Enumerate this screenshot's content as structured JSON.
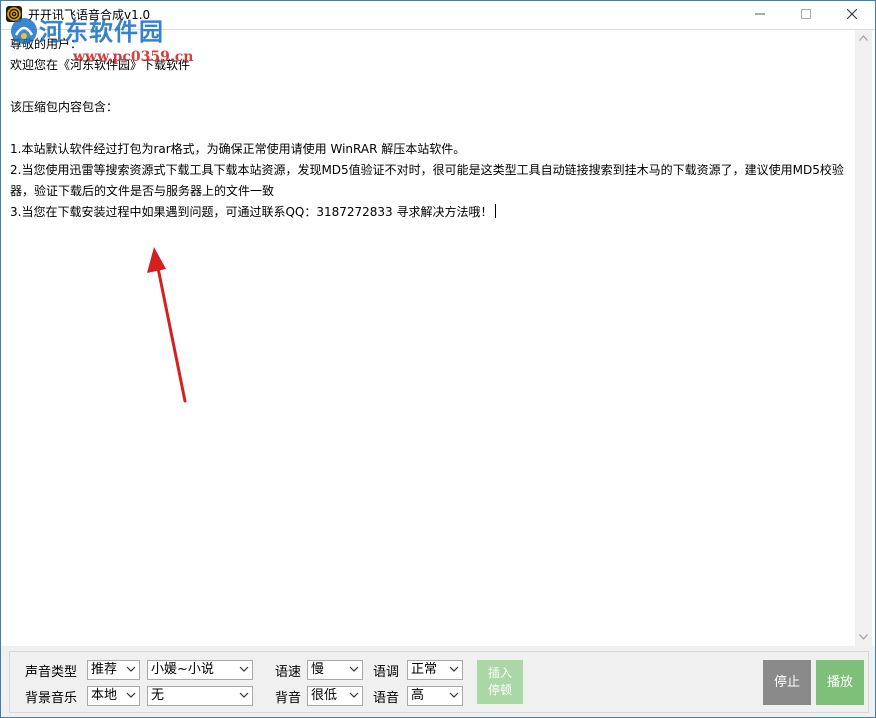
{
  "window": {
    "title": "开开讯飞语音合成v1.0"
  },
  "watermark": {
    "title": "河东软件园",
    "url": "www.pc0359.cn"
  },
  "editor": {
    "lines": [
      "尊敬的用户：",
      "欢迎您在《河东软件园》下载软件",
      "",
      "该压缩包内容包含：",
      "",
      "1.本站默认软件经过打包为rar格式，为确保正常使用请使用 WinRAR 解压本站软件。",
      "2.当您使用迅雷等搜索资源式下载工具下载本站资源，发现MD5值验证不对时，很可能是这类型工具自动链接搜索到挂木马的下载资源了，建议使用MD5校验",
      "器，验证下载后的文件是否与服务器上的文件一致",
      "3.当您在下载安装过程中如果遇到问题，可通过联系QQ：3187272833 寻求解决方法哦！"
    ]
  },
  "controls": {
    "voice_type_label": "声音类型",
    "voice_type_value": "推荐",
    "voice_name_value": "小媛~小说",
    "bg_music_label": "背景音乐",
    "bg_music_value": "本地",
    "bg_music_file_value": "无",
    "speed_label": "语速",
    "speed_value": "慢",
    "tone_label": "语调",
    "tone_value": "正常",
    "bg_volume_label": "背音",
    "bg_volume_value": "很低",
    "volume_label": "语音",
    "volume_value": "高",
    "insert_pause_line1": "插入",
    "insert_pause_line2": "停顿",
    "stop_label": "停止",
    "play_label": "播放"
  },
  "colors": {
    "accent_red": "#d42020",
    "play_green": "#7ec07a",
    "insert_green": "#a9d8a6",
    "stop_gray": "#8a8a8a"
  }
}
